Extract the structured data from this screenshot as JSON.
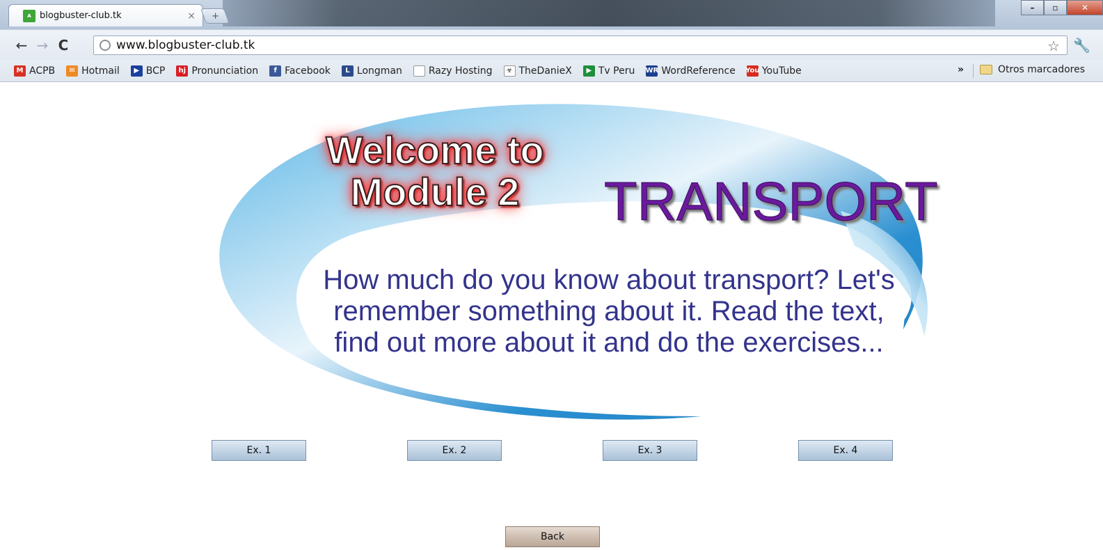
{
  "browser": {
    "tab_title": "blogbuster-club.tk",
    "tab_close": "×",
    "new_tab": "+",
    "url": "www.blogbuster-club.tk",
    "window_controls": {
      "minimize": "–",
      "maximize": "▫",
      "close": "✕"
    },
    "bookmarks": [
      {
        "label": "ACPB",
        "icon": "gmail-icon",
        "icon_text": "M",
        "color": "#d93025"
      },
      {
        "label": "Hotmail",
        "icon": "hotmail-icon",
        "icon_text": "✉",
        "color": "#f08a24"
      },
      {
        "label": "BCP",
        "icon": "bcp-icon",
        "icon_text": "▶",
        "color": "#1b3f9c"
      },
      {
        "label": "Pronunciation",
        "icon": "hj-icon",
        "icon_text": "hj",
        "color": "#d81f26"
      },
      {
        "label": "Facebook",
        "icon": "facebook-icon",
        "icon_text": "f",
        "color": "#3b5998"
      },
      {
        "label": "Longman",
        "icon": "longman-icon",
        "icon_text": "L",
        "color": "#2b4a8a"
      },
      {
        "label": "Razy Hosting",
        "icon": "page-icon",
        "icon_text": "",
        "color": "#ffffff"
      },
      {
        "label": "TheDanieX",
        "icon": "biohazard-icon",
        "icon_text": "☣",
        "color": "#ffffff"
      },
      {
        "label": "Tv Peru",
        "icon": "tvperu-icon",
        "icon_text": "▶",
        "color": "#1e8f3a"
      },
      {
        "label": "WordReference",
        "icon": "wordreference-icon",
        "icon_text": "WR",
        "color": "#1a3f8f"
      },
      {
        "label": "YouTube",
        "icon": "youtube-icon",
        "icon_text": "You",
        "color": "#d62c1f"
      }
    ],
    "more_bookmarks": "»",
    "other_bookmarks": "Otros marcadores"
  },
  "page": {
    "welcome_line1": "Welcome to",
    "welcome_line2": "Module 2",
    "heading": "TRANSPORT",
    "intro": "How much do you know about transport? Let's remember something about it. Read the text, find out more about it and do the exercises...",
    "exercise_buttons": [
      "Ex. 1",
      "Ex. 2",
      "Ex. 3",
      "Ex. 4"
    ],
    "back_label": "Back"
  },
  "colors": {
    "swoosh_blue": "#2a8fd0",
    "transport_purple": "#6a1a9c",
    "intro_text": "#33338c",
    "welcome_glow": "#ff3b3b"
  }
}
